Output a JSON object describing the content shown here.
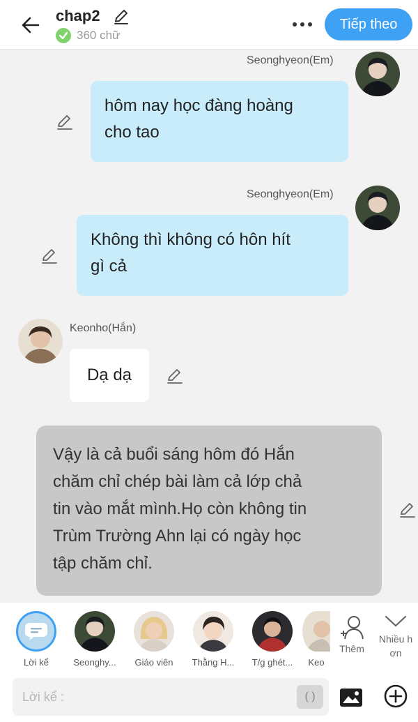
{
  "header": {
    "title": "chap2",
    "word_count": "360 chữ",
    "next_label": "Tiếp theo",
    "accent_color": "#3fa1f3"
  },
  "messages": [
    {
      "speaker": "Seonghyeon(Em)",
      "text_line1": "hôm nay học đàng hoàng",
      "text_line2": "cho tao",
      "side": "right",
      "bubble_color": "#c9ecfb"
    },
    {
      "speaker": "Seonghyeon(Em)",
      "text_line1": "Không thì không có hôn hít",
      "text_line2": "gì cả",
      "side": "right",
      "bubble_color": "#c9ecfb"
    },
    {
      "speaker": "Keonho(Hắn)",
      "text": "Dạ dạ",
      "side": "left",
      "bubble_color": "#ffffff"
    },
    {
      "type": "narration",
      "lines": [
        "Vậy là cả buổi sáng hôm đó Hắn",
        "chăm chỉ chép bài làm cả lớp chả",
        "tin vào mắt mình.Họ còn không tin",
        "Trùm Trường Ahn lại có ngày học",
        "tập chăm chỉ."
      ],
      "bubble_color": "#c8c8c8"
    }
  ],
  "characters": [
    {
      "label": "Lời kể",
      "active": true
    },
    {
      "label": "Seonghy..."
    },
    {
      "label": "Giáo viên"
    },
    {
      "label": "Thằng H..."
    },
    {
      "label": "T/g ghét..."
    },
    {
      "label": "Keo"
    }
  ],
  "them_label": "Thêm",
  "more_label_line1": "Nhiều h",
  "more_label_line2": "ơn",
  "input": {
    "placeholder": "Lời kể :",
    "paren": "( )"
  }
}
